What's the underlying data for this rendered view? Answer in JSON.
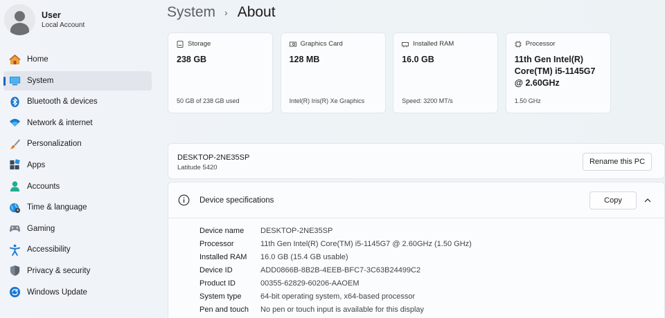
{
  "user": {
    "name": "User",
    "account_type": "Local Account"
  },
  "nav": {
    "items": [
      {
        "label": "Home",
        "icon": "home-icon"
      },
      {
        "label": "System",
        "icon": "system-icon",
        "active": true
      },
      {
        "label": "Bluetooth & devices",
        "icon": "bluetooth-icon"
      },
      {
        "label": "Network & internet",
        "icon": "wifi-icon"
      },
      {
        "label": "Personalization",
        "icon": "brush-icon"
      },
      {
        "label": "Apps",
        "icon": "apps-icon"
      },
      {
        "label": "Accounts",
        "icon": "person-icon"
      },
      {
        "label": "Time & language",
        "icon": "globe-icon"
      },
      {
        "label": "Gaming",
        "icon": "controller-icon"
      },
      {
        "label": "Accessibility",
        "icon": "accessibility-icon"
      },
      {
        "label": "Privacy & security",
        "icon": "shield-icon"
      },
      {
        "label": "Windows Update",
        "icon": "update-icon"
      }
    ]
  },
  "breadcrumb": {
    "parent": "System",
    "separator": "›",
    "current": "About"
  },
  "cards": [
    {
      "title": "Storage",
      "icon": "storage-icon",
      "value": "238 GB",
      "detail": "50 GB of 238 GB used"
    },
    {
      "title": "Graphics Card",
      "icon": "graphics-card-icon",
      "value": "128 MB",
      "detail": "Intel(R) Iris(R) Xe Graphics"
    },
    {
      "title": "Installed RAM",
      "icon": "ram-icon",
      "value": "16.0 GB",
      "detail": "Speed: 3200 MT/s"
    },
    {
      "title": "Processor",
      "icon": "processor-icon",
      "value": "11th Gen Intel(R) Core(TM) i5-1145G7 @ 2.60GHz",
      "detail": "1.50 GHz"
    }
  ],
  "pc": {
    "name": "DESKTOP-2NE35SP",
    "model": "Latitude 5420",
    "rename_label": "Rename this PC"
  },
  "specs": {
    "title": "Device specifications",
    "copy_label": "Copy",
    "rows": [
      {
        "label": "Device name",
        "value": "DESKTOP-2NE35SP"
      },
      {
        "label": "Processor",
        "value": "11th Gen Intel(R) Core(TM) i5-1145G7 @ 2.60GHz (1.50 GHz)"
      },
      {
        "label": "Installed RAM",
        "value": "16.0 GB (15.4 GB usable)"
      },
      {
        "label": "Device ID",
        "value": "ADD0866B-8B2B-4EEB-BFC7-3C63B24499C2"
      },
      {
        "label": "Product ID",
        "value": "00355-62829-60206-AAOEM"
      },
      {
        "label": "System type",
        "value": "64-bit operating system, x64-based processor"
      },
      {
        "label": "Pen and touch",
        "value": "No pen or touch input is available for this display"
      }
    ]
  },
  "colors": {
    "accent": "#0067c0",
    "background": "#eef3f8",
    "card": "#fbfcfd"
  }
}
